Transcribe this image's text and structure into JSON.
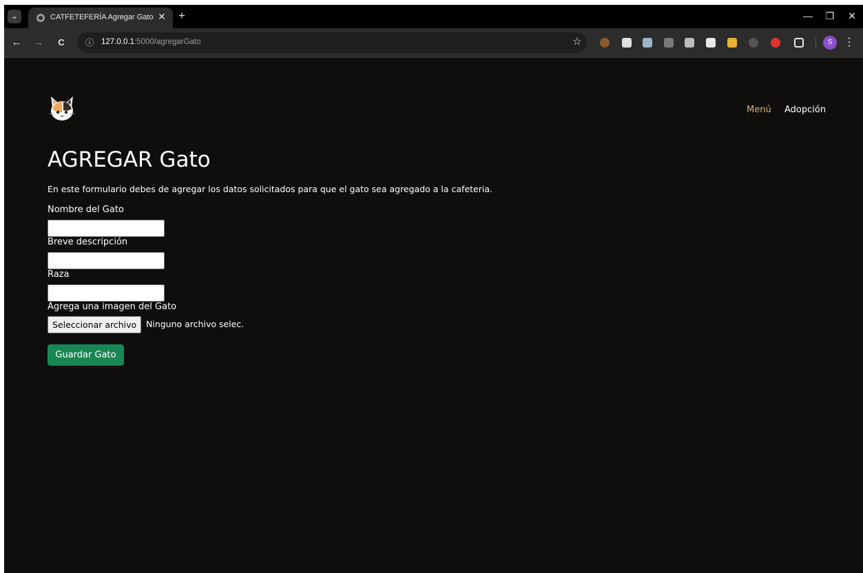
{
  "browser": {
    "tab": {
      "title": "CATFETEFERÍA Agregar Gato",
      "close_glyph": "✕",
      "favicon": "globe-icon"
    },
    "new_tab_glyph": "+",
    "tab_menu_glyph": "⌄",
    "window_controls": {
      "minimize": "—",
      "restore": "❐",
      "close": "✕"
    },
    "toolbar": {
      "back_glyph": "←",
      "forward_glyph": "→",
      "reload_glyph": "C",
      "site_info_glyph": "ⓘ",
      "url_host": "127.0.0.1",
      "url_path": ":5000/agregarGato",
      "bookmark_glyph": "☆",
      "profile_initial": "S",
      "menu_glyph": "⋮"
    },
    "extensions": [
      {
        "name": "extension-icon-1",
        "color": "#8a5a2b"
      },
      {
        "name": "extension-icon-2",
        "color": "#e0e0e0"
      },
      {
        "name": "extension-icon-3",
        "color": "#9fb3c8"
      },
      {
        "name": "extension-icon-4",
        "color": "#7a7a7a"
      },
      {
        "name": "extension-icon-5",
        "color": "#bdbdbd"
      },
      {
        "name": "extension-icon-6",
        "color": "#e8e8e8"
      },
      {
        "name": "extension-icon-7",
        "color": "#e9b13a"
      },
      {
        "name": "extension-icon-8",
        "color": "#555555"
      },
      {
        "name": "extension-icon-9",
        "color": "#e2332a"
      },
      {
        "name": "puzzle-icon",
        "color": "#e6e6e6"
      }
    ]
  },
  "page": {
    "logo": "cat-logo-icon",
    "nav": {
      "menu": "Menú",
      "adopcion": "Adopción"
    },
    "title": "AGREGAR Gato",
    "description": "En este formulario debes de agregar los datos solicitados para que el gato sea agregado a la cafeteria.",
    "form": {
      "name_label": "Nombre del Gato",
      "name_value": "",
      "description_label": "Breve descripción",
      "description_value": "",
      "breed_label": "Raza",
      "breed_value": "",
      "image_label": "Agrega una imagen del Gato",
      "file_button": "Seleccionar archivo",
      "file_status": "Ninguno archivo selec.",
      "submit": "Guardar Gato"
    }
  },
  "colors": {
    "page_background": "#0f0e0d",
    "active_nav": "#d7b27d",
    "submit_button": "#198754"
  }
}
